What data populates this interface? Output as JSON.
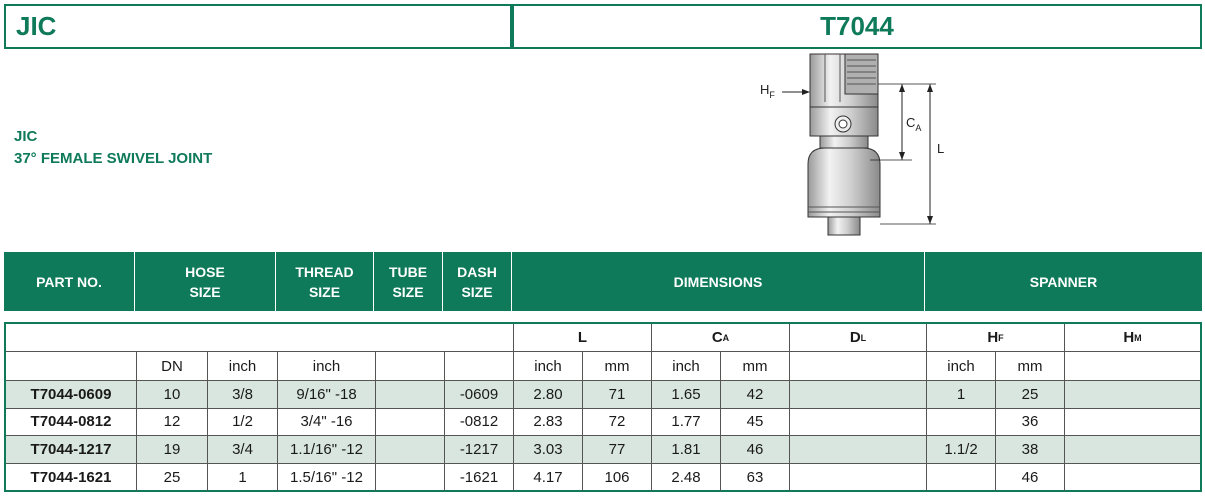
{
  "header": {
    "series": "JIC",
    "part": "T7044"
  },
  "subtitle": {
    "line1": "JIC",
    "line2": "37° FEMALE SWIVEL JOINT"
  },
  "drawing": {
    "hf": "H",
    "hf_sub": "F",
    "ca": "C",
    "ca_sub": "A",
    "l": "L"
  },
  "band": {
    "part_no": "PART NO.",
    "hose_size": [
      "HOSE",
      "SIZE"
    ],
    "thread_size": [
      "THREAD",
      "SIZE"
    ],
    "tube_size": [
      "TUBE",
      "SIZE"
    ],
    "dash_size": [
      "DASH",
      "SIZE"
    ],
    "dimensions": "DIMENSIONS",
    "spanner": "SPANNER"
  },
  "table": {
    "group_headers": {
      "l": "L",
      "ca": "C",
      "ca_sub": "A",
      "dl": "D",
      "dl_sub": "L",
      "hf": "H",
      "hf_sub": "F",
      "hm": "H",
      "hm_sub": "M"
    },
    "unit_headers": {
      "dn": "DN",
      "inch1": "inch",
      "inch2": "inch",
      "l_inch": "inch",
      "l_mm": "mm",
      "ca_inch": "inch",
      "ca_mm": "mm",
      "hf_inch": "inch",
      "hf_mm": "mm"
    },
    "rows": [
      {
        "part": "T7044-0609",
        "dn": "10",
        "inch": "3/8",
        "thread": "9/16\" -18",
        "tube": "",
        "dash": "-0609",
        "l_inch": "2.80",
        "l_mm": "71",
        "ca_inch": "1.65",
        "ca_mm": "42",
        "dl": "",
        "hf_inch": "1",
        "hf_mm": "25",
        "hm": ""
      },
      {
        "part": "T7044-0812",
        "dn": "12",
        "inch": "1/2",
        "thread": "3/4\" -16",
        "tube": "",
        "dash": "-0812",
        "l_inch": "2.83",
        "l_mm": "72",
        "ca_inch": "1.77",
        "ca_mm": "45",
        "dl": "",
        "hf_inch": "",
        "hf_mm": "36",
        "hm": ""
      },
      {
        "part": "T7044-1217",
        "dn": "19",
        "inch": "3/4",
        "thread": "1.1/16\" -12",
        "tube": "",
        "dash": "-1217",
        "l_inch": "3.03",
        "l_mm": "77",
        "ca_inch": "1.81",
        "ca_mm": "46",
        "dl": "",
        "hf_inch": "1.1/2",
        "hf_mm": "38",
        "hm": ""
      },
      {
        "part": "T7044-1621",
        "dn": "25",
        "inch": "1",
        "thread": "1.5/16\" -12",
        "tube": "",
        "dash": "-1621",
        "l_inch": "4.17",
        "l_mm": "106",
        "ca_inch": "2.48",
        "ca_mm": "63",
        "dl": "",
        "hf_inch": "",
        "hf_mm": "46",
        "hm": ""
      }
    ]
  }
}
